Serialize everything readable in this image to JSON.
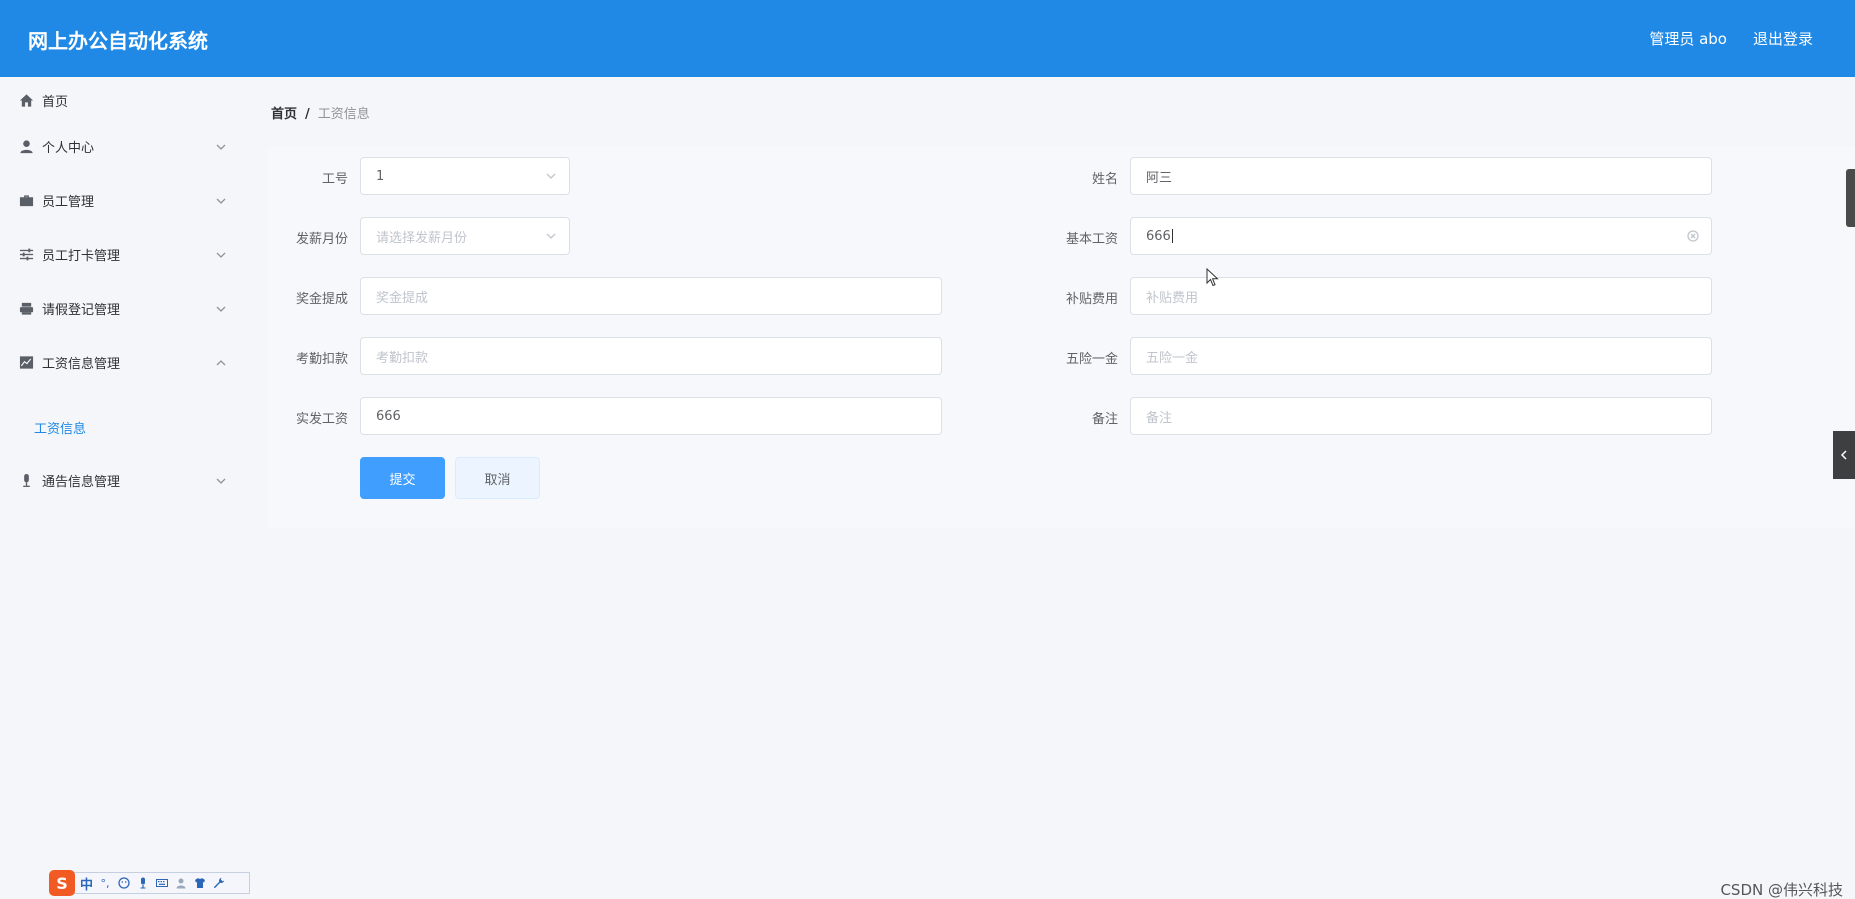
{
  "header": {
    "title": "网上办公自动化系统",
    "user_label": "管理员 abo",
    "logout_label": "退出登录"
  },
  "sidebar": {
    "items": [
      {
        "label": "首页",
        "icon": "home-icon"
      },
      {
        "label": "个人中心",
        "icon": "user-icon"
      },
      {
        "label": "员工管理",
        "icon": "briefcase-icon"
      },
      {
        "label": "员工打卡管理",
        "icon": "sliders-icon"
      },
      {
        "label": "请假登记管理",
        "icon": "printer-icon"
      },
      {
        "label": "工资信息管理",
        "icon": "chart-icon"
      },
      {
        "label": "通告信息管理",
        "icon": "microphone-icon"
      }
    ],
    "submenu": {
      "label": "工资信息"
    }
  },
  "breadcrumb": {
    "home": "首页",
    "separator": "/",
    "current": "工资信息"
  },
  "form": {
    "employee_no": {
      "label": "工号",
      "value": "1"
    },
    "name": {
      "label": "姓名",
      "value": "阿三"
    },
    "pay_month": {
      "label": "发薪月份",
      "placeholder": "请选择发薪月份"
    },
    "base_salary": {
      "label": "基本工资",
      "value": "666"
    },
    "bonus": {
      "label": "奖金提成",
      "placeholder": "奖金提成"
    },
    "subsidy": {
      "label": "补贴费用",
      "placeholder": "补贴费用"
    },
    "attendance_deduction": {
      "label": "考勤扣款",
      "placeholder": "考勤扣款"
    },
    "insurance": {
      "label": "五险一金",
      "placeholder": "五险一金"
    },
    "actual_salary": {
      "label": "实发工资",
      "value": "666"
    },
    "remark": {
      "label": "备注",
      "placeholder": "备注"
    }
  },
  "buttons": {
    "submit": "提交",
    "cancel": "取消"
  },
  "ime": {
    "logo": "S",
    "mode": "中",
    "punct": "°,"
  },
  "watermark": "CSDN @伟兴科技",
  "colors": {
    "header_bg": "#2089e6",
    "primary": "#409eff",
    "active_submenu": "#2089e6"
  }
}
